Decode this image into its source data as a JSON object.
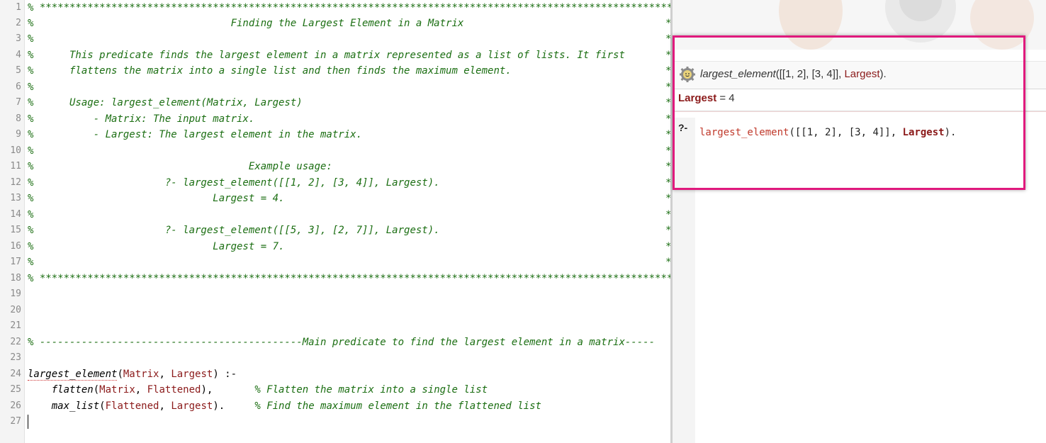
{
  "editor": {
    "line_numbers": [
      "1",
      "2",
      "3",
      "4",
      "5",
      "6",
      "7",
      "8",
      "9",
      "10",
      "11",
      "12",
      "13",
      "14",
      "15",
      "16",
      "17",
      "18",
      "19",
      "20",
      "21",
      "22",
      "23",
      "24",
      "25",
      "26",
      "27"
    ],
    "comment_lines": [
      "% ************************************************************************************************************",
      "%                                 Finding the Largest Element in a Matrix",
      "%",
      "%      This predicate finds the largest element in a matrix represented as a list of lists. It first",
      "%      flattens the matrix into a single list and then finds the maximum element.",
      "%",
      "%      Usage: largest_element(Matrix, Largest)",
      "%          - Matrix: The input matrix.",
      "%          - Largest: The largest element in the matrix.",
      "%",
      "%                                    Example usage:",
      "%                      ?- largest_element([[1, 2], [3, 4]], Largest).",
      "%                              Largest = 4.",
      "%",
      "%                      ?- largest_element([[5, 3], [2, 7]], Largest).",
      "%                              Largest = 7.",
      "%",
      "% ************************************************************************************************************"
    ],
    "end_star": "*",
    "section_comment": "% --------------------------------------------Main predicate to find the largest element in a matrix-----",
    "clause": {
      "head_pred": "largest_element",
      "head_open": "(",
      "head_var1": "Matrix",
      "head_sep": ", ",
      "head_var2": "Largest",
      "head_close": ") :-",
      "body1_indent": "    ",
      "body1_pred": "flatten",
      "body1_open": "(",
      "body1_var1": "Matrix",
      "body1_sep": ", ",
      "body1_var2": "Flattened",
      "body1_close": "),       ",
      "body1_comment": "% Flatten the matrix into a single list",
      "body2_indent": "    ",
      "body2_pred": "max_list",
      "body2_open": "(",
      "body2_var1": "Flattened",
      "body2_sep": ", ",
      "body2_var2": "Largest",
      "body2_close": ").     ",
      "body2_comment": "% Find the maximum element in the flattened list"
    }
  },
  "query_pane": {
    "header_pred": "largest_element",
    "header_args": "([[1, 2], [3, 4]], ",
    "header_var": "Largest",
    "header_end": ").",
    "answer_var": "Largest",
    "answer_eq": " = ",
    "answer_value": "4",
    "prompt": "?-",
    "query_pred": "largest_element",
    "query_args": "([[1, 2], [3, 4]], ",
    "query_var": "Largest",
    "query_end": ")."
  },
  "colors": {
    "comment": "#1b6e12",
    "variable": "#8b1a1a",
    "highlight_box": "#e0197d"
  },
  "icons": [
    "gear-icon"
  ]
}
